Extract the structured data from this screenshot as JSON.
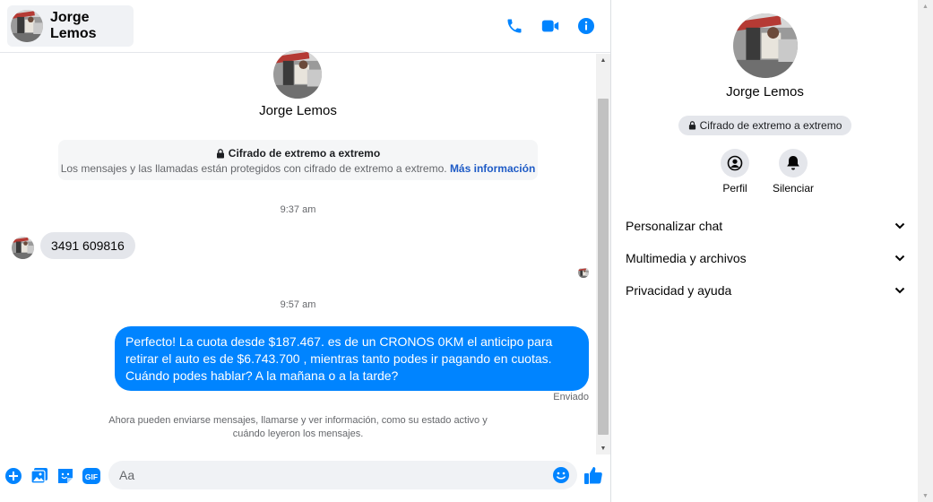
{
  "header": {
    "contact_name": "Jorge Lemos",
    "icons": [
      "phone-icon",
      "video-icon",
      "info-icon"
    ],
    "accent_color": "#0084ff"
  },
  "conversation": {
    "profile_name": "Jorge Lemos",
    "e2ee_notice": {
      "title": "Cifrado de extremo a extremo",
      "text": "Los mensajes y las llamadas están protegidos con cifrado de extremo a extremo.",
      "link": "Más información"
    },
    "timestamps": [
      "9:37 am",
      "9:57 am"
    ],
    "incoming_message": "3491 609816",
    "outgoing_message": "Perfecto! La cuota desde $187.467. es de un CRONOS 0KM el anticipo para retirar el auto es de $6.743.700 , mientras tanto podes ir pagando en cuotas. Cuándo podes hablar? A la mañana o a la tarde?",
    "sent_status": "Enviado",
    "info_note": "Ahora pueden enviarse mensajes, llamarse y ver información, como su estado activo y cuándo leyeron los mensajes."
  },
  "composer": {
    "placeholder": "Aa",
    "value": "",
    "icons": [
      "plus-icon",
      "image-icon",
      "sticker-icon",
      "gif-icon",
      "emoji-icon",
      "thumbs-up-icon"
    ],
    "gif_label": "GIF"
  },
  "info_panel": {
    "name": "Jorge Lemos",
    "e2ee_label": "Cifrado de extremo a extremo",
    "actions": [
      {
        "label": "Perfil",
        "icon": "profile-icon"
      },
      {
        "label": "Silenciar",
        "icon": "bell-icon"
      }
    ],
    "sections": [
      {
        "label": "Personalizar chat"
      },
      {
        "label": "Multimedia y archivos"
      },
      {
        "label": "Privacidad y ayuda"
      }
    ]
  }
}
